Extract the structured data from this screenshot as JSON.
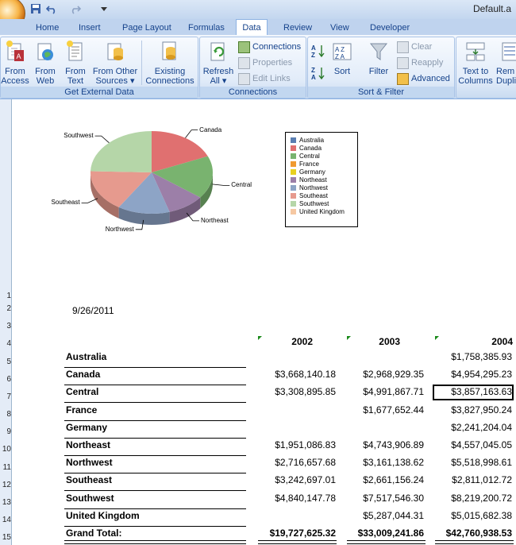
{
  "window": {
    "title": "Default.a"
  },
  "tabs": [
    "Home",
    "Insert",
    "Page Layout",
    "Formulas",
    "Data",
    "Review",
    "View",
    "Developer"
  ],
  "active_tab": "Data",
  "ribbon": {
    "get_external": {
      "label": "Get External Data",
      "from_access": [
        "From",
        "Access"
      ],
      "from_web": [
        "From",
        "Web"
      ],
      "from_text": [
        "From",
        "Text"
      ],
      "from_other": [
        "From Other",
        "Sources ▾"
      ],
      "existing": [
        "Existing",
        "Connections"
      ]
    },
    "connections": {
      "label": "Connections",
      "refresh": [
        "Refresh",
        "All ▾"
      ],
      "connections": "Connections",
      "properties": "Properties",
      "edit_links": "Edit Links"
    },
    "sort_filter": {
      "label": "Sort & Filter",
      "sort": "Sort",
      "filter": "Filter",
      "clear": "Clear",
      "reapply": "Reapply",
      "advanced": "Advanced"
    },
    "data_tools": {
      "text_to_columns": [
        "Text to",
        "Columns"
      ],
      "remove_dup": [
        "Rem",
        "Dupli"
      ]
    }
  },
  "row_numbers": [
    "1",
    "2",
    "3",
    "4",
    "5",
    "6",
    "7",
    "8",
    "9",
    "10",
    "11",
    "12",
    "13",
    "14",
    "15"
  ],
  "chart_data": {
    "type": "pie",
    "categories": [
      "Australia",
      "Canada",
      "Central",
      "France",
      "Germany",
      "Northeast",
      "Northwest",
      "Southeast",
      "Southwest",
      "United Kingdom"
    ],
    "values": [
      0,
      3668140.18,
      3308895.85,
      0,
      0,
      1951086.83,
      2716657.68,
      3242697.01,
      4840147.78,
      0
    ],
    "colors": [
      "#5a7eb1",
      "#e07070",
      "#79b36f",
      "#f09a30",
      "#e8d020",
      "#9c7fa8",
      "#8da4c6",
      "#e69a8e",
      "#b5d6a8",
      "#f6c8a2"
    ],
    "slice_labels": [
      "Canada",
      "Central",
      "Northeast",
      "Northwest",
      "Southeast",
      "Southwest"
    ],
    "legend": [
      "Australia",
      "Canada",
      "Central",
      "France",
      "Germany",
      "Northeast",
      "Northwest",
      "Southeast",
      "Southwest",
      "United Kingdom"
    ],
    "legend_position": "right"
  },
  "sheet": {
    "date": "9/26/2011",
    "years": [
      "2002",
      "2003",
      "2004"
    ],
    "rows": [
      {
        "name": "Australia",
        "v2002": "",
        "v2003": "",
        "v2004": "$1,758,385.93"
      },
      {
        "name": "Canada",
        "v2002": "$3,668,140.18",
        "v2003": "$2,968,929.35",
        "v2004": "$4,954,295.23"
      },
      {
        "name": "Central",
        "v2002": "$3,308,895.85",
        "v2003": "$4,991,867.71",
        "v2004": "$3,857,163.63"
      },
      {
        "name": "France",
        "v2002": "",
        "v2003": "$1,677,652.44",
        "v2004": "$3,827,950.24"
      },
      {
        "name": "Germany",
        "v2002": "",
        "v2003": "",
        "v2004": "$2,241,204.04"
      },
      {
        "name": "Northeast",
        "v2002": "$1,951,086.83",
        "v2003": "$4,743,906.89",
        "v2004": "$4,557,045.05"
      },
      {
        "name": "Northwest",
        "v2002": "$2,716,657.68",
        "v2003": "$3,161,138.62",
        "v2004": "$5,518,998.61"
      },
      {
        "name": "Southeast",
        "v2002": "$3,242,697.01",
        "v2003": "$2,661,156.24",
        "v2004": "$2,811,012.72"
      },
      {
        "name": "Southwest",
        "v2002": "$4,840,147.78",
        "v2003": "$7,517,546.30",
        "v2004": "$8,219,200.72"
      },
      {
        "name": "United Kingdom",
        "v2002": "",
        "v2003": "$5,287,044.31",
        "v2004": "$5,015,682.38"
      }
    ],
    "total": {
      "name": "Grand Total:",
      "v2002": "$19,727,625.32",
      "v2003": "$33,009,241.86",
      "v2004": "$42,760,938.53"
    }
  }
}
